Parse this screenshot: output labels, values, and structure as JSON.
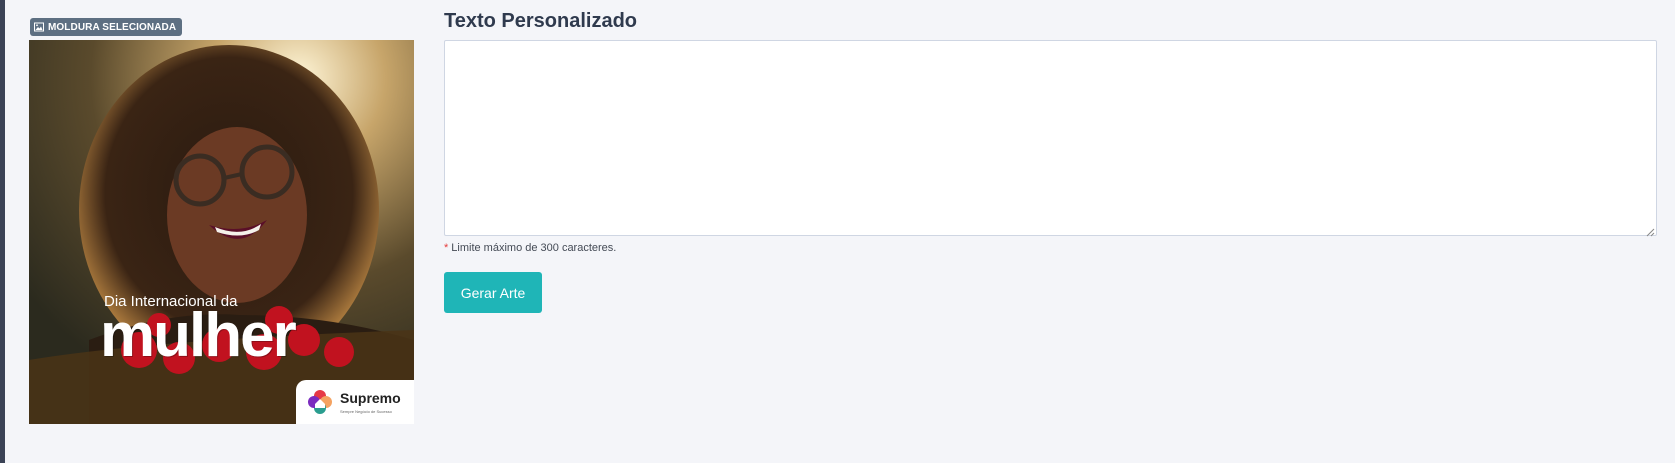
{
  "badge": {
    "label": "MOLDURA SELECIONADA",
    "icon": "image-icon"
  },
  "frame": {
    "small_title": "Dia Internacional da",
    "big_title": "mulher",
    "brand_name": "Supremo",
    "brand_tagline": "Sempre Negócio de Sucesso"
  },
  "form": {
    "title": "Texto Personalizado",
    "textarea_value": "",
    "textarea_placeholder": "",
    "hint_star": "*",
    "hint": "Limite máximo de 300 caracteres.",
    "button_label": "Gerar Arte"
  },
  "colors": {
    "accent": "#1fb5b7",
    "badge": "#5d6f82",
    "required": "#e53b3b"
  }
}
